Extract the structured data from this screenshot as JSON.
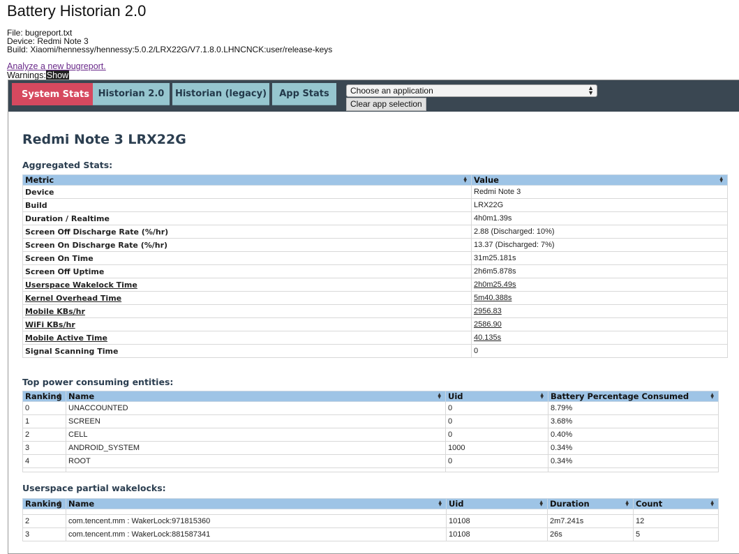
{
  "app_title": "Battery Historian 2.0",
  "file_info": {
    "file": "File: bugreport.txt",
    "device": "Device: Redmi Note 3",
    "build": "Build: Xiaomi/hennessy/hennessy:5.0.2/LRX22G/V7.1.8.0.LHNCNCK:user/release-keys"
  },
  "analyze_link": "Analyze a new bugreport.",
  "warnings": {
    "label": "Warnings:",
    "show": "Show"
  },
  "tabs": [
    {
      "label": "System Stats",
      "active": true
    },
    {
      "label": "Historian 2.0",
      "active": false
    },
    {
      "label": "Historian (legacy)",
      "active": false
    },
    {
      "label": "App Stats",
      "active": false
    }
  ],
  "app_select": {
    "value": "Choose an application"
  },
  "clear_button": "Clear app selection",
  "device_heading": "Redmi Note 3 LRX22G",
  "aggregated": {
    "title": "Aggregated Stats:",
    "headers": [
      "Metric",
      "Value"
    ],
    "rows": [
      {
        "metric": "Device",
        "value": "Redmi Note 3",
        "link": false
      },
      {
        "metric": "Build",
        "value": "LRX22G",
        "link": false
      },
      {
        "metric": "Duration / Realtime",
        "value": "4h0m1.39s",
        "link": false
      },
      {
        "metric": "Screen Off Discharge Rate (%/hr)",
        "value": "2.88 (Discharged: 10%)",
        "link": false
      },
      {
        "metric": "Screen On Discharge Rate (%/hr)",
        "value": "13.37 (Discharged: 7%)",
        "link": false
      },
      {
        "metric": "Screen On Time",
        "value": "31m25.181s",
        "link": false
      },
      {
        "metric": "Screen Off Uptime",
        "value": "2h6m5.878s",
        "link": false
      },
      {
        "metric": "Userspace Wakelock Time",
        "value": "2h0m25.49s",
        "link": true
      },
      {
        "metric": "Kernel Overhead Time",
        "value": "5m40.388s",
        "link": true
      },
      {
        "metric": "Mobile KBs/hr",
        "value": "2956.83",
        "link": true
      },
      {
        "metric": "WiFi KBs/hr",
        "value": "2586.90",
        "link": true
      },
      {
        "metric": "Mobile Active Time",
        "value": "40.135s",
        "link": true
      },
      {
        "metric": "Signal Scanning Time",
        "value": "0",
        "link": false
      }
    ]
  },
  "power": {
    "title": "Top power consuming entities:",
    "headers": [
      "Ranking",
      "Name",
      "Uid",
      "Battery Percentage Consumed"
    ],
    "rows": [
      [
        "0",
        "UNACCOUNTED",
        "0",
        "8.79%"
      ],
      [
        "1",
        "SCREEN",
        "0",
        "3.68%"
      ],
      [
        "2",
        "CELL",
        "0",
        "0.40%"
      ],
      [
        "3",
        "ANDROID_SYSTEM",
        "1000",
        "0.34%"
      ],
      [
        "4",
        "ROOT",
        "0",
        "0.34%"
      ]
    ]
  },
  "wakelocks": {
    "title": "Userspace partial wakelocks:",
    "headers": [
      "Ranking",
      "Name",
      "Uid",
      "Duration",
      "Count"
    ],
    "rows": [
      [
        "2",
        "com.tencent.mm : WakerLock:971815360",
        "10108",
        "2m7.241s",
        "12"
      ],
      [
        "3",
        "com.tencent.mm : WakerLock:881587341",
        "10108",
        "26s",
        "5"
      ]
    ]
  }
}
